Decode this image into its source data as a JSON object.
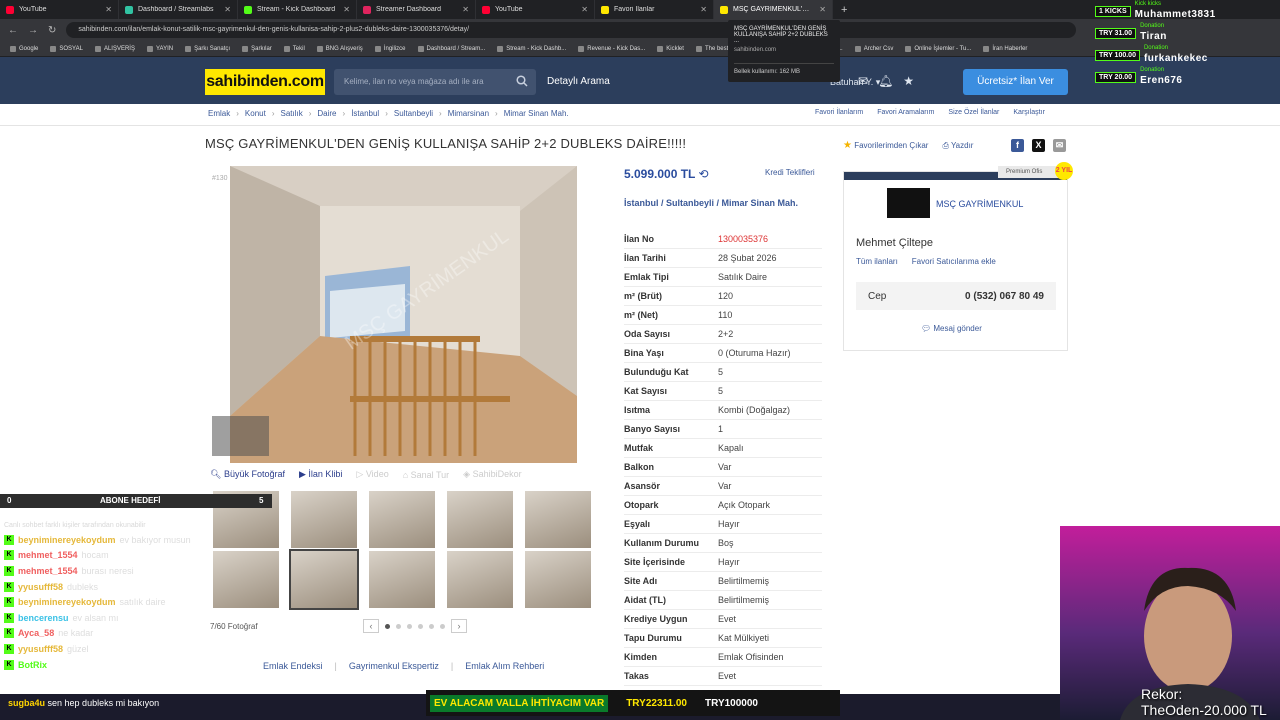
{
  "browser": {
    "tabs": [
      {
        "title": "YouTube",
        "color": "#ff0033",
        "active": false
      },
      {
        "title": "Dashboard / Streamlabs",
        "color": "#31c3a2",
        "active": false
      },
      {
        "title": "Stream - Kick Dashboard",
        "color": "#53fc18",
        "active": false
      },
      {
        "title": "Streamer Dashboard",
        "color": "#e0245e",
        "active": false
      },
      {
        "title": "YouTube",
        "color": "#ff0033",
        "active": false
      },
      {
        "title": "Favori İlanlar",
        "color": "#ffe800",
        "active": false
      },
      {
        "title": "MSÇ GAYRİMENKUL'DEN GENİŞ",
        "color": "#ffe800",
        "active": true
      }
    ],
    "url": "sahibinden.com/ilan/emlak-konut-satilik-msc-gayrimenkul-den-genis-kullanisa-sahip-2-plus2-dubleks-daire-1300035376/detay/",
    "bookmarks": [
      "Google",
      "SOSYAL",
      "ALIŞVERİŞ",
      "YAYIN",
      "Şarkı Sanatçı",
      "Şarkılar",
      "Tekil",
      "BNG Alışveriş",
      "İngilizce",
      "Dashboard / Stream...",
      "Stream - Kick Dashb...",
      "Revenue - Kick Das...",
      "Kicklet",
      "The best Chatbot an...",
      "Speedtest by Ookla...",
      "Archer Csv",
      "Online İşlemler - Tu...",
      "İran Haberler"
    ],
    "tooltip": {
      "title": "MSÇ GAYRİMENKUL'DEN GENİŞ KULLANIŞA SAHİP 2+2 DUBLEKS ...",
      "site": "sahibinden.com",
      "memory": "Bellek kullanımı: 162 MB"
    }
  },
  "header": {
    "logo": "sahibinden.com",
    "search_placeholder": "Kelime, ilan no veya mağaza adı ile ara",
    "detailed_search": "Detaylı Arama",
    "user_label": "Batuhan Y.",
    "post_button": "Ücretsiz* İlan Ver"
  },
  "breadcrumb": [
    "Emlak",
    "Konut",
    "Satılık",
    "Daire",
    "İstanbul",
    "Sultanbeyli",
    "Mimarsinan",
    "Mimar Sinan Mah."
  ],
  "right_links": [
    "Favori İlanlarım",
    "Favori Aramalarım",
    "Size Özel İlanlar",
    "Karşılaştır"
  ],
  "listing": {
    "title": "MSÇ GAYRİMENKUL'DEN GENİŞ KULLANIŞA SAHİP 2+2 DUBLEKS DAİRE!!!!!",
    "favorite_remove": "Favorilerimden Çıkar",
    "print": "Yazdır",
    "photo_id": "#130",
    "price": "5.099.000 TL",
    "credit_link": "Kredi Teklifleri",
    "location": "İstanbul  /  Sultanbeyli  /  Mimar Sinan Mah.",
    "details": [
      {
        "k": "İlan No",
        "v": "1300035376"
      },
      {
        "k": "İlan Tarihi",
        "v": "28 Şubat 2026"
      },
      {
        "k": "Emlak Tipi",
        "v": "Satılık Daire"
      },
      {
        "k": "m² (Brüt)",
        "v": "120"
      },
      {
        "k": "m² (Net)",
        "v": "110"
      },
      {
        "k": "Oda Sayısı",
        "v": "2+2"
      },
      {
        "k": "Bina Yaşı",
        "v": "0 (Oturuma Hazır)"
      },
      {
        "k": "Bulunduğu Kat",
        "v": "5"
      },
      {
        "k": "Kat Sayısı",
        "v": "5"
      },
      {
        "k": "Isıtma",
        "v": "Kombi (Doğalgaz)"
      },
      {
        "k": "Banyo Sayısı",
        "v": "1"
      },
      {
        "k": "Mutfak",
        "v": "Kapalı"
      },
      {
        "k": "Balkon",
        "v": "Var"
      },
      {
        "k": "Asansör",
        "v": "Var"
      },
      {
        "k": "Otopark",
        "v": "Açık Otopark"
      },
      {
        "k": "Eşyalı",
        "v": "Hayır"
      },
      {
        "k": "Kullanım Durumu",
        "v": "Boş"
      },
      {
        "k": "Site İçerisinde",
        "v": "Hayır"
      },
      {
        "k": "Site Adı",
        "v": "Belirtilmemiş"
      },
      {
        "k": "Aidat (TL)",
        "v": "Belirtilmemiş"
      },
      {
        "k": "Krediye Uygun",
        "v": "Evet"
      },
      {
        "k": "Tapu Durumu",
        "v": "Kat Mülkiyeti"
      },
      {
        "k": "Kimden",
        "v": "Emlak Ofisinden"
      },
      {
        "k": "Takas",
        "v": "Evet"
      }
    ],
    "media": {
      "big_photo": "Büyük Fotoğraf",
      "video_clip": "İlan Klibi",
      "video": "Video",
      "virtual_tour": "Sanal Tur",
      "dekor": "SahibiDekor",
      "photo_count": "7/60 Fotoğraf"
    },
    "footer_links": [
      "Emlak Endeksi",
      "Gayrimenkul Ekspertiz",
      "Emlak Alım Rehberi"
    ]
  },
  "seller": {
    "premium": "Premium Ofis",
    "badge": "2 YIL",
    "store": "MSÇ GAYRİMENKUL",
    "agent": "Mehmet Çiltepe",
    "all_listings": "Tüm ilanları",
    "add_favorite": "Favori Satıcılarıma ekle",
    "phone_label": "Cep",
    "phone": "0 (532) 067 80 49",
    "message": "Mesaj gönder"
  },
  "stream": {
    "sub_goal": {
      "count": "0",
      "label": "ABONE HEDEFİ",
      "max": "5"
    },
    "chat_notice": "Canlı sohbet farklı kişiler tarafından okunabilir",
    "chat": [
      {
        "user": "beyniminereyekoydum",
        "color": "#e5b83a",
        "msg": "ev bakıyor musun"
      },
      {
        "user": "mehmet_1554",
        "color": "#f06060",
        "msg": "hocam"
      },
      {
        "user": "mehmet_1554",
        "color": "#f06060",
        "msg": "burası neresi"
      },
      {
        "user": "yyusufff58",
        "color": "#e5b83a",
        "msg": "dubleks"
      },
      {
        "user": "beyniminereyekoydum",
        "color": "#e5b83a",
        "msg": "satılık daire"
      },
      {
        "user": "bencerensu",
        "color": "#3bc2e6",
        "msg": "ev alsan mı"
      },
      {
        "user": "Ayca_58",
        "color": "#f06060",
        "msg": "ne kadar"
      },
      {
        "user": "yyusufff58",
        "color": "#e5b83a",
        "msg": "güzel"
      },
      {
        "user": "BotRix",
        "color": "#53fc18",
        "msg": ""
      }
    ],
    "bottom_chat_user": "sugba4u",
    "bottom_chat_msg": "sen hep dubleks mi bakıyon",
    "ticker": {
      "main": "EV ALACAM VALLA İHTİYACIM VAR",
      "a": "TRY22311.00",
      "b": "TRY100000"
    },
    "kicks": [
      {
        "tag": "1 KICKS",
        "label": "Kick kicks",
        "name": "Muhammet3831"
      },
      {
        "tag": "TRY 31.00",
        "label": "Donation",
        "name": "Tiran"
      },
      {
        "tag": "TRY 100.00",
        "label": "Donation",
        "name": "furkankekec"
      },
      {
        "tag": "TRY 20.00",
        "label": "Donation",
        "name": "Eren676"
      }
    ],
    "record": "Rekor:",
    "record_value": "TheOden-20.000 TL"
  }
}
